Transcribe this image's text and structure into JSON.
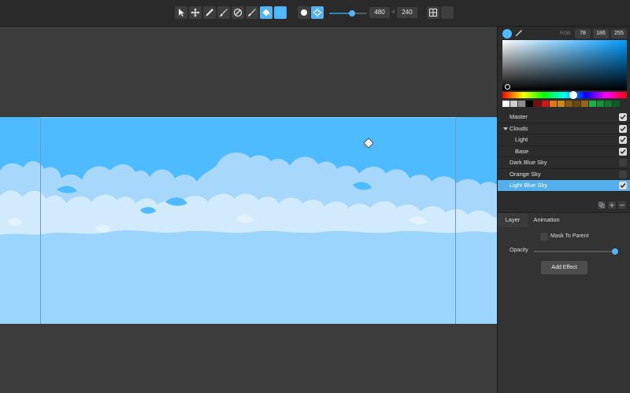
{
  "toolbar": {
    "tools": [
      {
        "icon": "arrow-icon",
        "active": false
      },
      {
        "icon": "move-icon",
        "active": false
      },
      {
        "icon": "pencil-icon",
        "active": false
      },
      {
        "icon": "brush-icon",
        "active": false
      },
      {
        "icon": "blend-icon",
        "active": false
      },
      {
        "icon": "smudge-icon",
        "active": false
      },
      {
        "icon": "fill-bucket-icon",
        "active": true
      },
      {
        "icon": "color-swatch-icon",
        "active": true
      }
    ],
    "brush_shapes": [
      {
        "icon": "round-brush-icon",
        "active": false
      },
      {
        "icon": "pixel-brush-icon",
        "active": true
      }
    ],
    "brush_size_fraction": 0.6,
    "width": "480",
    "size_separator": "x",
    "height": "240",
    "grid_icon": "grid-icon"
  },
  "color": {
    "accent": "#4ebaff",
    "rgb_label": "RGB:",
    "r": "78",
    "g": "186",
    "b": "255",
    "palette": [
      "#ffffff",
      "#cfcfcf",
      "#8f8f8f",
      "#000000",
      "#7a0d0d",
      "#d01616",
      "#e0761c",
      "#c98a1a",
      "#8a5a14",
      "#6b4a12",
      "#9a6418",
      "#19b14a",
      "#14923a",
      "#0f7a2e",
      "#0c5f24"
    ]
  },
  "layers": [
    {
      "name": "Master",
      "indent": 0,
      "visible": true,
      "group": false,
      "selected": false
    },
    {
      "name": "Clouds",
      "indent": 0,
      "visible": true,
      "group": true,
      "selected": false
    },
    {
      "name": "Light",
      "indent": 1,
      "visible": true,
      "group": false,
      "selected": false
    },
    {
      "name": "Base",
      "indent": 1,
      "visible": true,
      "group": false,
      "selected": false
    },
    {
      "name": "Dark Blue Sky",
      "indent": 0,
      "visible": false,
      "group": false,
      "selected": false
    },
    {
      "name": "Orange Sky",
      "indent": 0,
      "visible": false,
      "group": false,
      "selected": false
    },
    {
      "name": "Light Blue Sky",
      "indent": 0,
      "visible": true,
      "group": false,
      "selected": true
    }
  ],
  "layer_actions": [
    "duplicate-layer-icon",
    "add-layer-icon",
    "remove-layer-icon"
  ],
  "props": {
    "tabs": [
      "Layer",
      "Animation"
    ],
    "active_tab": 0,
    "mask_label": "Mask To Parent",
    "mask_checked": false,
    "opacity_label": "Opacity",
    "opacity": 1.0,
    "add_effect": "Add Effect"
  },
  "canvas": {
    "sky_color": "#4ebaff",
    "cloud_shadow": "#a7d8fb",
    "cloud_base": "#d1ebfd",
    "lower_sky": "#9bd5fd"
  }
}
